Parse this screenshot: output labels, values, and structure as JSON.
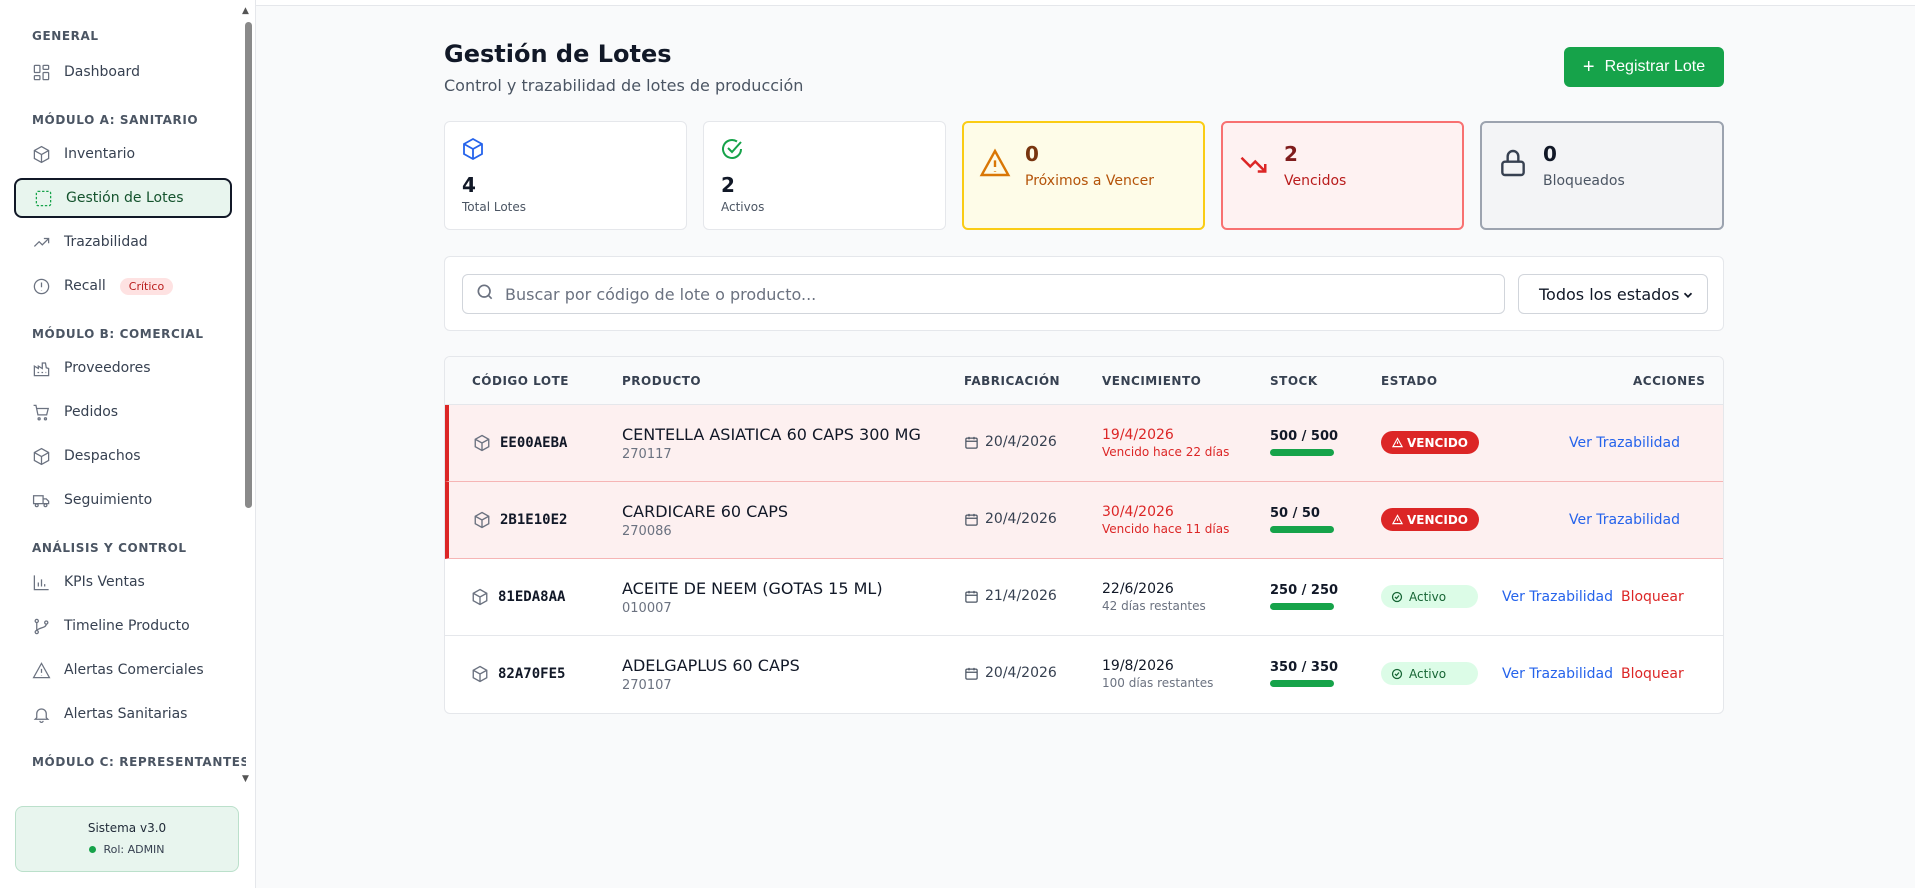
{
  "sidebar": {
    "sections": [
      {
        "title": "GENERAL",
        "items": [
          {
            "label": "Dashboard",
            "icon": "dashboard-icon"
          }
        ]
      },
      {
        "title": "MÓDULO A: SANITARIO",
        "items": [
          {
            "label": "Inventario",
            "icon": "package-icon"
          },
          {
            "label": "Gestión de Lotes",
            "icon": "dashed-box-icon",
            "active": true
          },
          {
            "label": "Trazabilidad",
            "icon": "trend-up-icon"
          },
          {
            "label": "Recall",
            "icon": "alert-circle-icon",
            "badge": "Crítico"
          }
        ]
      },
      {
        "title": "MÓDULO B: COMERCIAL",
        "items": [
          {
            "label": "Proveedores",
            "icon": "factory-icon"
          },
          {
            "label": "Pedidos",
            "icon": "cart-icon"
          },
          {
            "label": "Despachos",
            "icon": "package-icon"
          },
          {
            "label": "Seguimiento",
            "icon": "truck-icon"
          }
        ]
      },
      {
        "title": "ANÁLISIS Y CONTROL",
        "items": [
          {
            "label": "KPIs Ventas",
            "icon": "bar-chart-icon"
          },
          {
            "label": "Timeline Producto",
            "icon": "git-branch-icon"
          },
          {
            "label": "Alertas Comerciales",
            "icon": "warning-icon"
          },
          {
            "label": "Alertas Sanitarias",
            "icon": "bell-icon"
          }
        ]
      },
      {
        "title": "MÓDULO C: REPRESENTANTES",
        "items": []
      }
    ],
    "system": {
      "version": "Sistema v3.0",
      "role": "Rol: ADMIN"
    }
  },
  "header": {
    "title": "Gestión de Lotes",
    "subtitle": "Control y trazabilidad de lotes de producción",
    "register_button": "Registrar Lote"
  },
  "stats": [
    {
      "value": "4",
      "label": "Total Lotes",
      "icon": "package-icon",
      "color": "#2563eb"
    },
    {
      "value": "2",
      "label": "Activos",
      "icon": "check-circle-icon",
      "color": "#16a34a"
    },
    {
      "value": "0",
      "label": "Próximos a Vencer",
      "icon": "warning-icon",
      "color": "#d97706"
    },
    {
      "value": "2",
      "label": "Vencidos",
      "icon": "trend-down-icon",
      "color": "#dc2626"
    },
    {
      "value": "0",
      "label": "Bloqueados",
      "icon": "lock-icon",
      "color": "#374151"
    }
  ],
  "filters": {
    "search_placeholder": "Buscar por código de lote o producto...",
    "status_selected": "Todos los estados"
  },
  "table": {
    "headers": [
      "CÓDIGO LOTE",
      "PRODUCTO",
      "FABRICACIÓN",
      "VENCIMIENTO",
      "STOCK",
      "ESTADO",
      "ACCIONES"
    ],
    "rows": [
      {
        "code": "EE00AEBA",
        "product": "CENTELLA ASIATICA 60 CAPS 300 MG",
        "product_code": "270117",
        "fabrication": "20/4/2026",
        "expiry": "19/4/2026",
        "expiry_note": "Vencido hace 22 días",
        "stock": "500 / 500",
        "stock_fraction": 1.0,
        "status": "VENCIDO",
        "action_primary": "Ver Trazabilidad",
        "action_secondary": ""
      },
      {
        "code": "2B1E10E2",
        "product": "CARDICARE 60 CAPS",
        "product_code": "270086",
        "fabrication": "20/4/2026",
        "expiry": "30/4/2026",
        "expiry_note": "Vencido hace 11 días",
        "stock": "50 / 50",
        "stock_fraction": 1.0,
        "status": "VENCIDO",
        "action_primary": "Ver Trazabilidad",
        "action_secondary": ""
      },
      {
        "code": "81EDA8AA",
        "product": "ACEITE DE NEEM (GOTAS 15 ML)",
        "product_code": "010007",
        "fabrication": "21/4/2026",
        "expiry": "22/6/2026",
        "expiry_note": "42 días restantes",
        "stock": "250 / 250",
        "stock_fraction": 1.0,
        "status": "Activo",
        "action_primary": "Ver Trazabilidad",
        "action_secondary": "Bloquear"
      },
      {
        "code": "82A70FE5",
        "product": "ADELGAPLUS 60 CAPS",
        "product_code": "270107",
        "fabrication": "20/4/2026",
        "expiry": "19/8/2026",
        "expiry_note": "100 días restantes",
        "stock": "350 / 350",
        "stock_fraction": 1.0,
        "status": "Activo",
        "action_primary": "Ver Trazabilidad",
        "action_secondary": "Bloquear"
      }
    ]
  }
}
